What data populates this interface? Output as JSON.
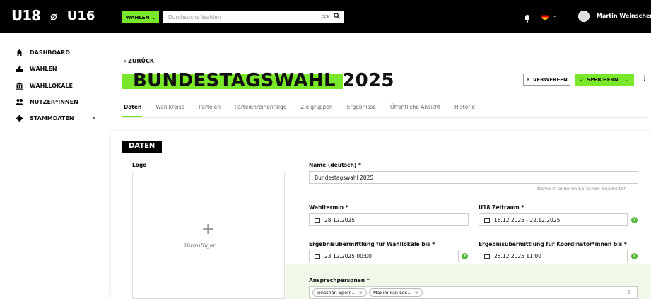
{
  "header": {
    "logo_u18": "U18",
    "logo_u16": "U16",
    "wahlen_label": "WAHLEN",
    "search_placeholder": "Durchsuche Wahlen",
    "search_shortcut": "⌘K",
    "user_name": "Martin Weinschenk"
  },
  "sidebar": {
    "items": [
      {
        "label": "DASHBOARD",
        "icon": "home-icon"
      },
      {
        "label": "WAHLEN",
        "icon": "ballot-icon"
      },
      {
        "label": "WAHLLOKALE",
        "icon": "building-icon"
      },
      {
        "label": "NUTZER*INNEN",
        "icon": "users-icon"
      },
      {
        "label": "STAMMDATEN",
        "icon": "gear-icon"
      }
    ]
  },
  "page": {
    "back_label": "ZURÜCK",
    "title": "BUNDESTAGSWAHL 2025",
    "discard_label": "VERWERFEN",
    "save_label": "SPEICHERN",
    "tabs": [
      "Daten",
      "Wahlkreise",
      "Parteien",
      "Parteienreihenfolge",
      "Zielgruppen",
      "Ergebnisse",
      "Öffentliche Ansicht",
      "Historie"
    ],
    "active_tab": "Daten"
  },
  "form": {
    "section_title": "DATEN",
    "logo_label": "Logo",
    "logo_add": "Hinzufügen",
    "name_label": "Name (deutsch) *",
    "name_value": "Bundestagswahl 2025",
    "name_hint": "Name in anderen Sprachen bearbeiten",
    "wahltermin_label": "Wahltermin *",
    "wahltermin_value": "28.12.2025",
    "zeitraum_label": "U18 Zeitraum *",
    "zeitraum_value": "16.12.2025 - 22.12.2025",
    "ergebnis_wahllokale_label": "Ergebnisübermittlung für Wahllokale bis *",
    "ergebnis_wahllokale_value": "23.12.2025 00:00",
    "ergebnis_koordinator_label": "Ergebnisübermittlung für Koordinator*innen bis *",
    "ergebnis_koordinator_value": "25.12.2025 11:00",
    "ansprech_label": "Ansprechpersonen *",
    "ansprech_chips": [
      "Jonathan Sperr...",
      "Maximilian Lor..."
    ]
  },
  "colors": {
    "accent": "#7ae82a",
    "help": "#55b93b"
  }
}
